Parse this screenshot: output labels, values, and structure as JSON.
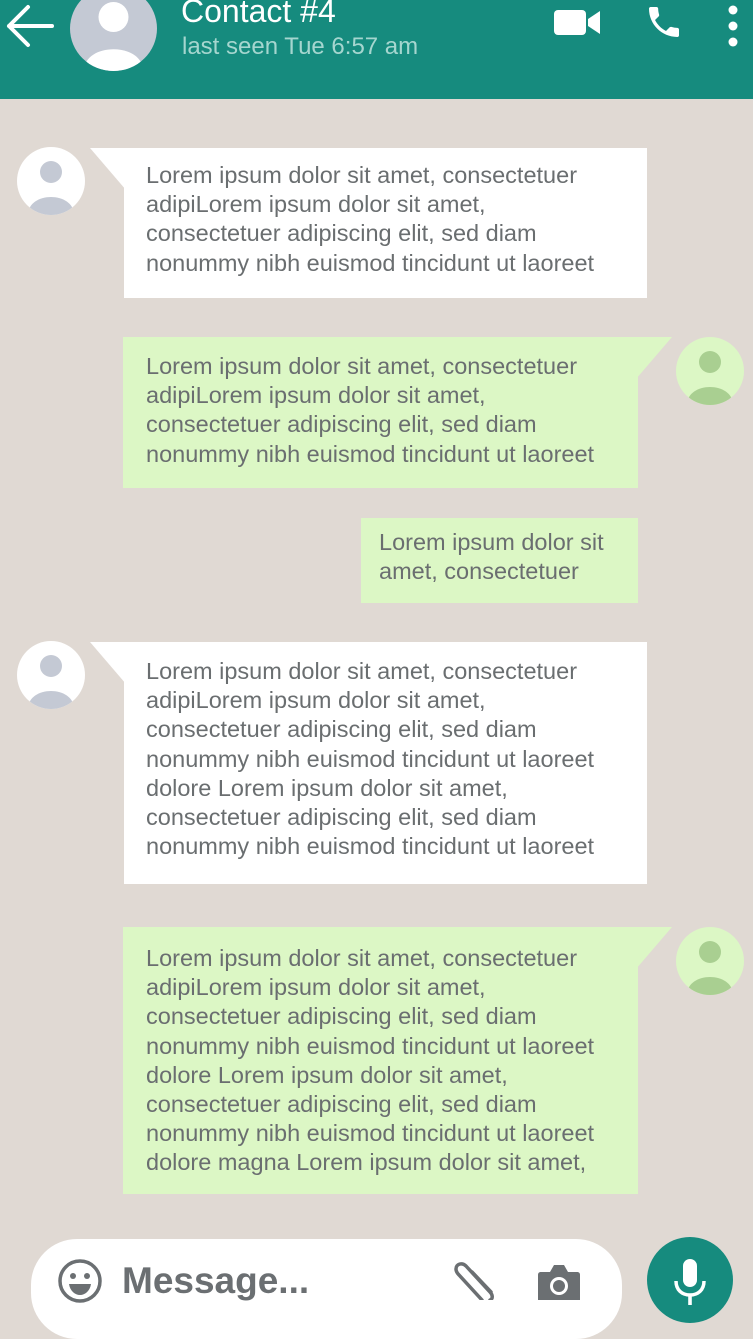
{
  "header": {
    "contact_name": "Contact #4",
    "status": "last seen Tue 6:57 am",
    "icons": [
      "back-arrow-icon",
      "avatar-icon",
      "video-call-icon",
      "phone-icon",
      "more-vert-icon"
    ]
  },
  "messages": [
    {
      "direction": "incoming",
      "text": "Lorem ipsum dolor sit amet, consectetuer\nadipiLorem ipsum dolor sit amet,\nconsectetuer adipiscing elit, sed diam\nnonummy nibh euismod tincidunt ut laoreet"
    },
    {
      "direction": "outgoing",
      "text": "Lorem ipsum dolor sit amet, consectetuer\nadipiLorem ipsum dolor sit amet,\nconsectetuer adipiscing elit, sed diam\nnonummy nibh euismod tincidunt ut laoreet"
    },
    {
      "direction": "outgoing",
      "text": "Lorem ipsum dolor sit\namet, consectetuer"
    },
    {
      "direction": "incoming",
      "text": "Lorem ipsum dolor sit amet, consectetuer\nadipiLorem ipsum dolor sit amet,\nconsectetuer adipiscing elit, sed diam\nnonummy nibh euismod tincidunt ut laoreet\ndolore Lorem ipsum dolor sit amet,\nconsectetuer adipiscing elit, sed diam\nnonummy nibh euismod tincidunt ut laoreet"
    },
    {
      "direction": "outgoing",
      "text": "Lorem ipsum dolor sit amet, consectetuer\nadipiLorem ipsum dolor sit amet,\nconsectetuer adipiscing elit, sed diam\nnonummy nibh euismod tincidunt ut laoreet\ndolore Lorem ipsum dolor sit amet,\nconsectetuer adipiscing elit, sed diam\nnonummy nibh euismod tincidunt ut laoreet\ndolore magna Lorem ipsum dolor sit amet,"
    }
  ],
  "composer": {
    "placeholder": "Message...",
    "icons": [
      "emoji-icon",
      "attachment-icon",
      "camera-icon",
      "microphone-icon"
    ]
  },
  "colors": {
    "header": "#168b7e",
    "chat_background": "#e0d9d3",
    "incoming_bubble": "#ffffff",
    "outgoing_bubble": "#dcf7c5",
    "message_text": "#6a6e70",
    "status_text": "#a5d6cf"
  }
}
